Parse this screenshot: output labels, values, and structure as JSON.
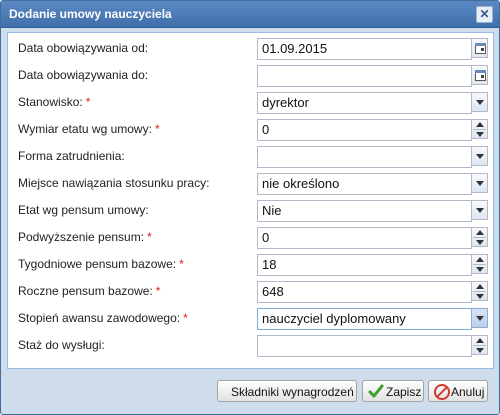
{
  "dialog": {
    "title": "Dodanie umowy nauczyciela",
    "close_label": "✕"
  },
  "required_marker": "*",
  "fields": [
    {
      "label": "Data obowiązywania od:",
      "value": "01.09.2015",
      "type": "date",
      "required": false
    },
    {
      "label": "Data obowiązywania do:",
      "value": "",
      "type": "date",
      "required": false
    },
    {
      "label": "Stanowisko:",
      "value": "dyrektor",
      "type": "select",
      "required": true
    },
    {
      "label": "Wymiar etatu wg umowy:",
      "value": "0",
      "type": "number",
      "required": true
    },
    {
      "label": "Forma zatrudnienia:",
      "value": "",
      "type": "select",
      "required": false
    },
    {
      "label": "Miejsce nawiązania stosunku pracy:",
      "value": "nie określono",
      "type": "select",
      "required": false
    },
    {
      "label": "Etat wg pensum umowy:",
      "value": "Nie",
      "type": "select",
      "required": false
    },
    {
      "label": "Podwyższenie pensum:",
      "value": "0",
      "type": "number",
      "required": true
    },
    {
      "label": "Tygodniowe pensum bazowe:",
      "value": "18",
      "type": "number",
      "required": true
    },
    {
      "label": "Roczne pensum bazowe:",
      "value": "648",
      "type": "number",
      "required": true
    },
    {
      "label": "Stopień awansu zawodowego:",
      "value": "nauczyciel dyplomowany",
      "type": "select",
      "required": true
    },
    {
      "label": "Staż do wysługi:",
      "value": "",
      "type": "number",
      "required": false
    }
  ],
  "buttons": {
    "components": "Składniki wynagrodzeń",
    "save": "Zapisz",
    "cancel": "Anuluj"
  }
}
